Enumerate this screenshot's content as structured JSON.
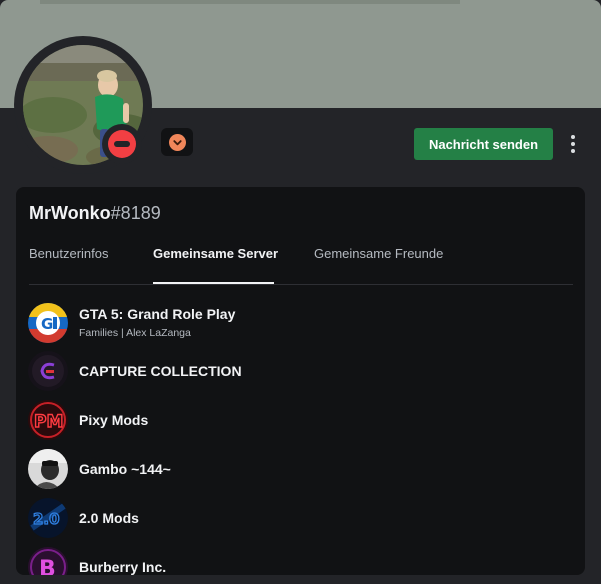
{
  "profile": {
    "username": "MrWonko",
    "discriminator": "#8189",
    "send_message_label": "Nachricht senden"
  },
  "tabs": [
    {
      "label": "Benutzerinfos"
    },
    {
      "label": "Gemeinsame Server"
    },
    {
      "label": "Gemeinsame Freunde"
    }
  ],
  "servers": [
    {
      "name": "GTA 5: Grand Role Play",
      "subtitle": "Families | Alex LaZanga",
      "icon": "gta-rp-logo"
    },
    {
      "name": "CAPTURE COLLECTION",
      "icon": "capture-logo"
    },
    {
      "name": "Pixy Mods",
      "icon": "pixy-mods-logo"
    },
    {
      "name": "Gambo ~144~",
      "icon": "gambo-logo"
    },
    {
      "name": "2.0 Mods",
      "icon": "2-0-mods-logo"
    },
    {
      "name": "Burberry Inc.",
      "icon": "burberry-logo"
    }
  ],
  "colors": {
    "accent_button": "#248046",
    "status_dnd": "#f23f43",
    "badge": "#f0865a",
    "card_bg": "#111214",
    "page_bg": "#232428"
  }
}
